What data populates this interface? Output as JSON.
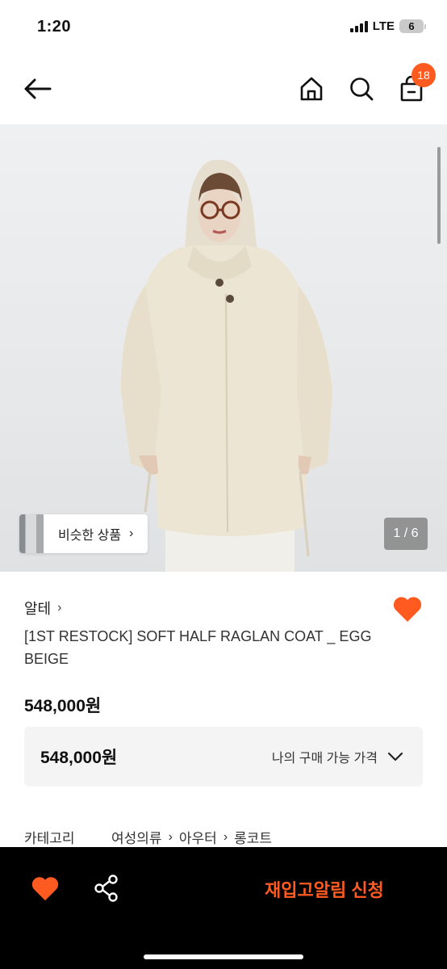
{
  "status": {
    "time": "1:20",
    "network": "LTE",
    "battery": "6"
  },
  "nav": {
    "cart_count": "18",
    "icons": [
      "arrow-left-icon",
      "home-icon",
      "search-icon",
      "shopping-bag-icon"
    ]
  },
  "gallery": {
    "similar_label": "비슷한 상품",
    "counter": "1 / 6",
    "image_subject": "product-photo"
  },
  "product": {
    "brand": "알테",
    "title": "[1ST RESTOCK] SOFT HALF RAGLAN COAT _ EGG BEIGE",
    "price": "548,000원",
    "my_price": "548,000원",
    "my_price_label": "나의 구매 가능 가격",
    "liked": true
  },
  "category": {
    "label": "카테고리",
    "crumbs": [
      "여성의류",
      "아우터",
      "롱코트"
    ]
  },
  "bottom": {
    "cta": "재입고알림 신청"
  },
  "colors": {
    "accent": "#ff5a1f",
    "bottom_bar": "#000000"
  }
}
